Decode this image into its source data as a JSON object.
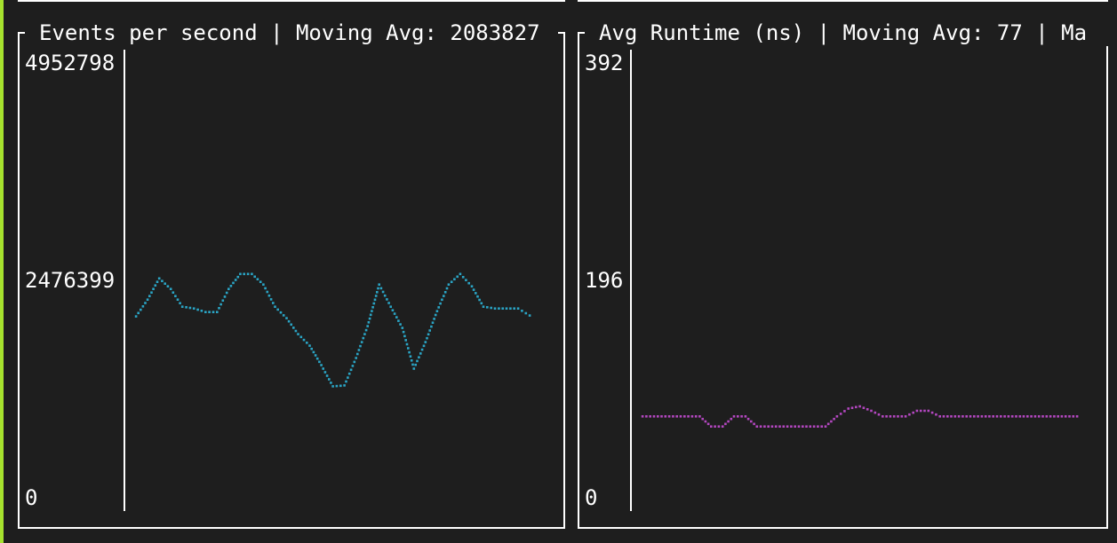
{
  "colors": {
    "background": "#1e1e1e",
    "border": "#ffffff",
    "accent": "#a6e22e",
    "events_series": "#2aa4c4",
    "runtime_series": "#b347c0"
  },
  "panels": [
    {
      "id": "events",
      "title": "Events per second | Moving Avg: 2083827",
      "y_ticks": [
        "4952798",
        "2476399",
        "0"
      ],
      "series_color": "#2aa4c4"
    },
    {
      "id": "runtime",
      "title": "Avg Runtime (ns) | Moving Avg: 77 | Ma",
      "y_ticks": [
        "392",
        "196",
        "0"
      ],
      "series_color": "#b347c0"
    }
  ],
  "chart_data": [
    {
      "type": "line",
      "title": "Events per second | Moving Avg: 2083827",
      "ylim": [
        0,
        4952798
      ],
      "y_ticks": [
        0,
        2476399,
        4952798
      ],
      "series": [
        {
          "values": [
            2090000,
            2280000,
            2520000,
            2400000,
            2200000,
            2180000,
            2140000,
            2140000,
            2400000,
            2570000,
            2570000,
            2450000,
            2200000,
            2070000,
            1890000,
            1760000,
            1540000,
            1300000,
            1310000,
            1620000,
            1980000,
            2450000,
            2200000,
            1960000,
            1500000,
            1800000,
            2150000,
            2450000,
            2570000,
            2430000,
            2200000,
            2180000,
            2180000,
            2180000,
            2100000
          ]
        }
      ]
    },
    {
      "type": "line",
      "title": "Avg Runtime (ns) | Moving Avg: 77 | Ma",
      "ylim": [
        0,
        392
      ],
      "y_ticks": [
        0,
        196,
        392
      ],
      "series": [
        {
          "values": [
            76,
            76,
            76,
            76,
            76,
            76,
            67,
            67,
            76,
            76,
            67,
            67,
            67,
            67,
            67,
            67,
            67,
            76,
            83,
            85,
            81,
            76,
            76,
            76,
            81,
            81,
            76,
            76,
            76,
            76,
            76,
            76,
            76,
            76,
            76,
            76,
            76,
            76,
            76
          ]
        }
      ]
    }
  ]
}
